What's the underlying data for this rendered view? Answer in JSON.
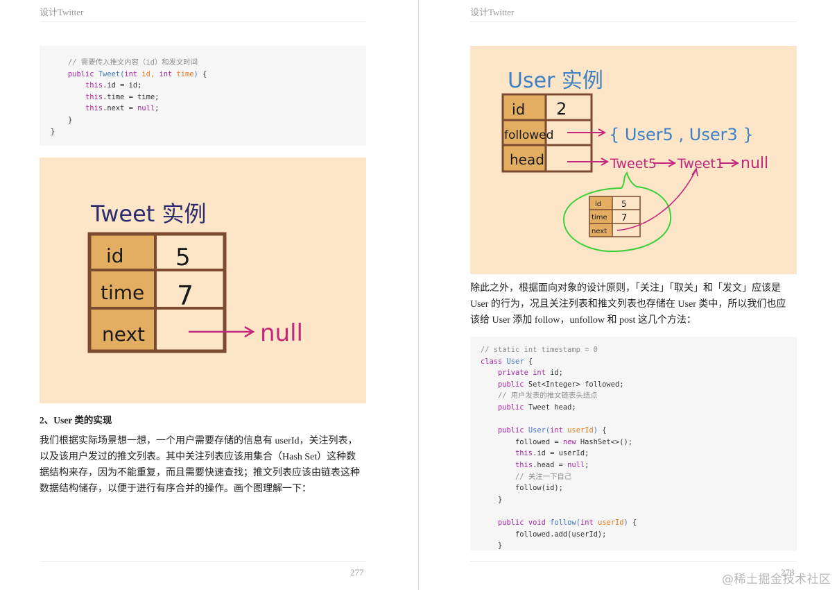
{
  "left_page": {
    "header": "设计Twitter",
    "page_number": "277",
    "code_lines": [
      [
        {
          "t": "    "
        },
        {
          "t": "// 需要传入推文内容（id）和发文时间",
          "c": "com"
        }
      ],
      [
        {
          "t": "    "
        },
        {
          "t": "public",
          "c": "kw"
        },
        {
          "t": " "
        },
        {
          "t": "Tweet",
          "c": "fn"
        },
        {
          "t": "(",
          "c": "fn"
        },
        {
          "t": "int",
          "c": "kw"
        },
        {
          "t": " id, ",
          "c": "pm"
        },
        {
          "t": "int",
          "c": "kw"
        },
        {
          "t": " time",
          "c": "pm"
        },
        {
          "t": ")",
          "c": "fn"
        },
        {
          "t": " {"
        }
      ],
      [
        {
          "t": "        "
        },
        {
          "t": "this",
          "c": "kw"
        },
        {
          "t": ".id = id;"
        }
      ],
      [
        {
          "t": "        "
        },
        {
          "t": "this",
          "c": "kw"
        },
        {
          "t": ".time = time;"
        }
      ],
      [
        {
          "t": "        "
        },
        {
          "t": "this",
          "c": "kw"
        },
        {
          "t": ".next = "
        },
        {
          "t": "null",
          "c": "kw"
        },
        {
          "t": ";"
        }
      ],
      [
        {
          "t": "    }"
        }
      ],
      [
        {
          "t": "}"
        }
      ]
    ],
    "figure": {
      "title": "Tweet 实例",
      "rows": [
        {
          "key": "id",
          "value": "5"
        },
        {
          "key": "time",
          "value": "7"
        },
        {
          "key": "next",
          "value": ""
        }
      ],
      "null_label": "null"
    },
    "section_heading": "2、User 类的实现",
    "paragraph": [
      "我们根据实际场景想一想，一个用户需要存储的信息有 userId，关注列表，",
      "以及该用户发过的推文列表。其中关注列表应该用集合（Hash Set）这种数",
      "据结构来存，因为不能重复，而且需要快速查找；推文列表应该由链表这种",
      "数据结构储存，以便于进行有序合并的操作。画个图理解一下："
    ]
  },
  "right_page": {
    "header": "设计Twitter",
    "page_number": "278",
    "figure": {
      "title": "User 实例",
      "rows": [
        {
          "key": "id",
          "value": "2"
        },
        {
          "key": "followed",
          "value": ""
        },
        {
          "key": "head",
          "value": ""
        }
      ],
      "followed_set": "{ User5 , User3 }",
      "tweet5": "Tweet5",
      "tweet1": "Tweet1",
      "null_label": "null",
      "mini_rows": [
        {
          "key": "id",
          "value": "5"
        },
        {
          "key": "time",
          "value": "7"
        },
        {
          "key": "next",
          "value": ""
        }
      ]
    },
    "paragraph": [
      "除此之外，根据面向对象的设计原则，「关注」「取关」和「发文」应该是",
      "User 的行为，况且关注列表和推文列表也存储在 User 类中，所以我们也应",
      "该给 User 添加 follow，unfollow 和 post 这几个方法："
    ],
    "code_lines": [
      [
        {
          "t": "// static int timestamp = 0",
          "c": "com"
        }
      ],
      [
        {
          "t": "class",
          "c": "kw"
        },
        {
          "t": " "
        },
        {
          "t": "User",
          "c": "fn"
        },
        {
          "t": " {"
        }
      ],
      [
        {
          "t": "    "
        },
        {
          "t": "private",
          "c": "kw"
        },
        {
          "t": " "
        },
        {
          "t": "int",
          "c": "kw"
        },
        {
          "t": " id;"
        }
      ],
      [
        {
          "t": "    "
        },
        {
          "t": "public",
          "c": "kw"
        },
        {
          "t": " Set<Integer> followed;"
        }
      ],
      [
        {
          "t": "    "
        },
        {
          "t": "// 用户发表的推文链表头结点",
          "c": "com"
        }
      ],
      [
        {
          "t": "    "
        },
        {
          "t": "public",
          "c": "kw"
        },
        {
          "t": " Tweet head;"
        }
      ],
      [
        {
          "t": ""
        }
      ],
      [
        {
          "t": "    "
        },
        {
          "t": "public",
          "c": "kw"
        },
        {
          "t": " "
        },
        {
          "t": "User",
          "c": "fn"
        },
        {
          "t": "(",
          "c": "fn"
        },
        {
          "t": "int",
          "c": "kw"
        },
        {
          "t": " userId",
          "c": "pm"
        },
        {
          "t": ")",
          "c": "fn"
        },
        {
          "t": " {"
        }
      ],
      [
        {
          "t": "        followed = "
        },
        {
          "t": "new",
          "c": "kw"
        },
        {
          "t": " HashSet<>();"
        }
      ],
      [
        {
          "t": "        "
        },
        {
          "t": "this",
          "c": "kw"
        },
        {
          "t": ".id = userId;"
        }
      ],
      [
        {
          "t": "        "
        },
        {
          "t": "this",
          "c": "kw"
        },
        {
          "t": ".head = "
        },
        {
          "t": "null",
          "c": "kw"
        },
        {
          "t": ";"
        }
      ],
      [
        {
          "t": "        "
        },
        {
          "t": "// 关注一下自己",
          "c": "com"
        }
      ],
      [
        {
          "t": "        follow(id);"
        }
      ],
      [
        {
          "t": "    }"
        }
      ],
      [
        {
          "t": ""
        }
      ],
      [
        {
          "t": "    "
        },
        {
          "t": "public",
          "c": "kw"
        },
        {
          "t": " "
        },
        {
          "t": "void",
          "c": "kw"
        },
        {
          "t": " "
        },
        {
          "t": "follow",
          "c": "fn"
        },
        {
          "t": "(",
          "c": "fn"
        },
        {
          "t": "int",
          "c": "kw"
        },
        {
          "t": " userId",
          "c": "pm"
        },
        {
          "t": ")",
          "c": "fn"
        },
        {
          "t": " {"
        }
      ],
      [
        {
          "t": "        followed.add(userId);"
        }
      ],
      [
        {
          "t": "    }"
        }
      ]
    ]
  },
  "watermark": "@稀土掘金技术社区",
  "colors": {
    "figure_bg": "#fce6c7",
    "cell_key": "#e3ad62",
    "cell_border": "#7b4a31",
    "handwriting": "#2b2d6e",
    "arrow": "#c2277b",
    "blue_text": "#3e80c6",
    "green_circle": "#3dcf3a"
  }
}
